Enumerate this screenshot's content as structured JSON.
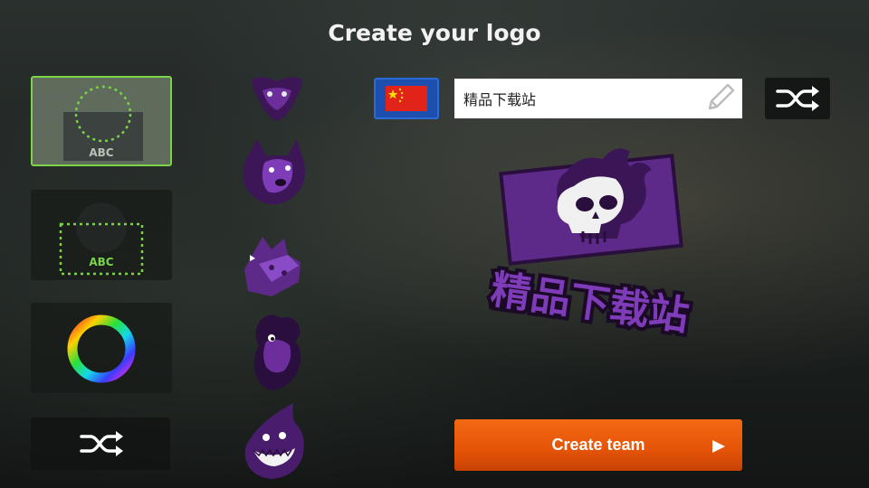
{
  "header": {
    "title": "Create your logo"
  },
  "layout_options": [
    {
      "label": "ABC",
      "selected": true
    },
    {
      "label": "ABC",
      "selected": false
    }
  ],
  "color_picker": {
    "icon": "color-wheel-icon"
  },
  "shuffle_small": {
    "icon": "shuffle-icon"
  },
  "emblems": [
    {
      "icon": "demon-emblem-icon"
    },
    {
      "icon": "wolf-emblem-icon"
    },
    {
      "icon": "cheese-emblem-icon"
    },
    {
      "icon": "bird-emblem-icon"
    },
    {
      "icon": "shark-emblem-icon"
    }
  ],
  "country": {
    "icon": "china-flag-icon"
  },
  "team_name": {
    "value": "精品下载站",
    "edit_icon": "pencil-icon"
  },
  "shuffle_top": {
    "icon": "shuffle-icon"
  },
  "preview": {
    "text": "精品下载站",
    "icon": "skull-logo-icon"
  },
  "create_button": {
    "label": "Create team",
    "icon": "play-arrow-icon"
  },
  "colors": {
    "accent_green": "#7bd348",
    "emblem_purple": "#5e2a8a",
    "button_orange": "#e45307",
    "flag_blue": "#1d4fae"
  }
}
